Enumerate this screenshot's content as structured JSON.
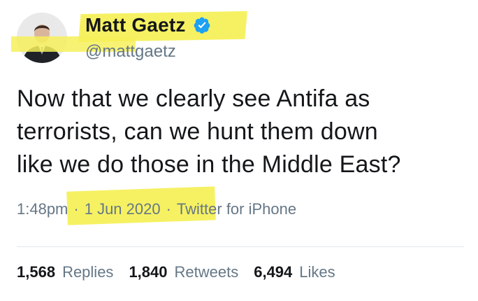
{
  "author": {
    "display_name": "Matt Gaetz",
    "handle": "@mattgaetz",
    "verified_icon": "verified-badge-icon",
    "avatar_icon": "profile-photo-avatar"
  },
  "tweet": {
    "text_lines": [
      "Now that we clearly see Antifa as",
      "terrorists, can we hunt them down",
      "like we do those in the Middle East?"
    ],
    "time": "1:48pm",
    "separator": "·",
    "date": "1 Jun 2020",
    "source": "Twitter for iPhone"
  },
  "stats": [
    {
      "count": "1,568",
      "label": "Replies"
    },
    {
      "count": "1,840",
      "label": "Retweets"
    },
    {
      "count": "6,494",
      "label": "Likes"
    }
  ],
  "colors": {
    "highlight": "#f6f05a",
    "verified": "#1da1f2",
    "secondary_text": "#657786",
    "primary_text": "#14171a"
  }
}
